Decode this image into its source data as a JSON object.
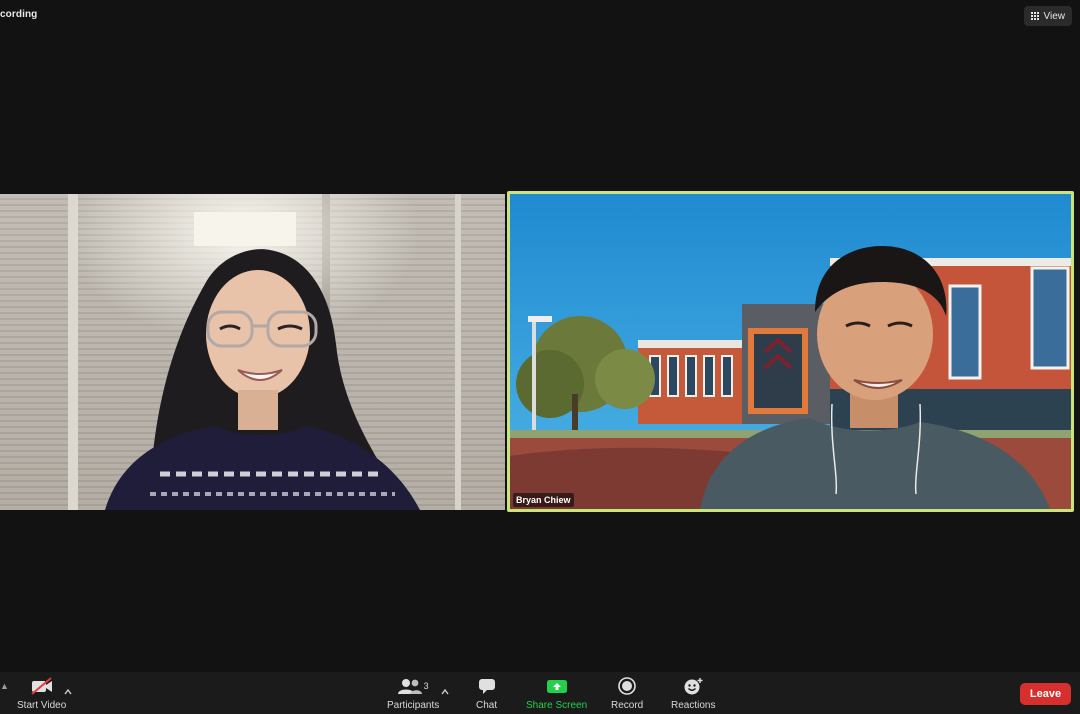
{
  "header": {
    "recording_text": "cording",
    "view_label": "View"
  },
  "participants_tiles": {
    "right_name": "Bryan Chiew"
  },
  "toolbar": {
    "start_video": "Start Video",
    "participants": "Participants",
    "participants_count": "3",
    "chat": "Chat",
    "share_screen": "Share Screen",
    "record": "Record",
    "reactions": "Reactions",
    "leave": "Leave"
  },
  "colors": {
    "active_speaker_border": "#c9e47d",
    "share_green": "#22d04a",
    "leave_red": "#d72e2e"
  },
  "icons": [
    "grid-icon",
    "video-off-icon",
    "participants-icon",
    "chat-icon",
    "share-screen-icon",
    "record-icon",
    "reactions-icon",
    "caret-up-icon"
  ]
}
